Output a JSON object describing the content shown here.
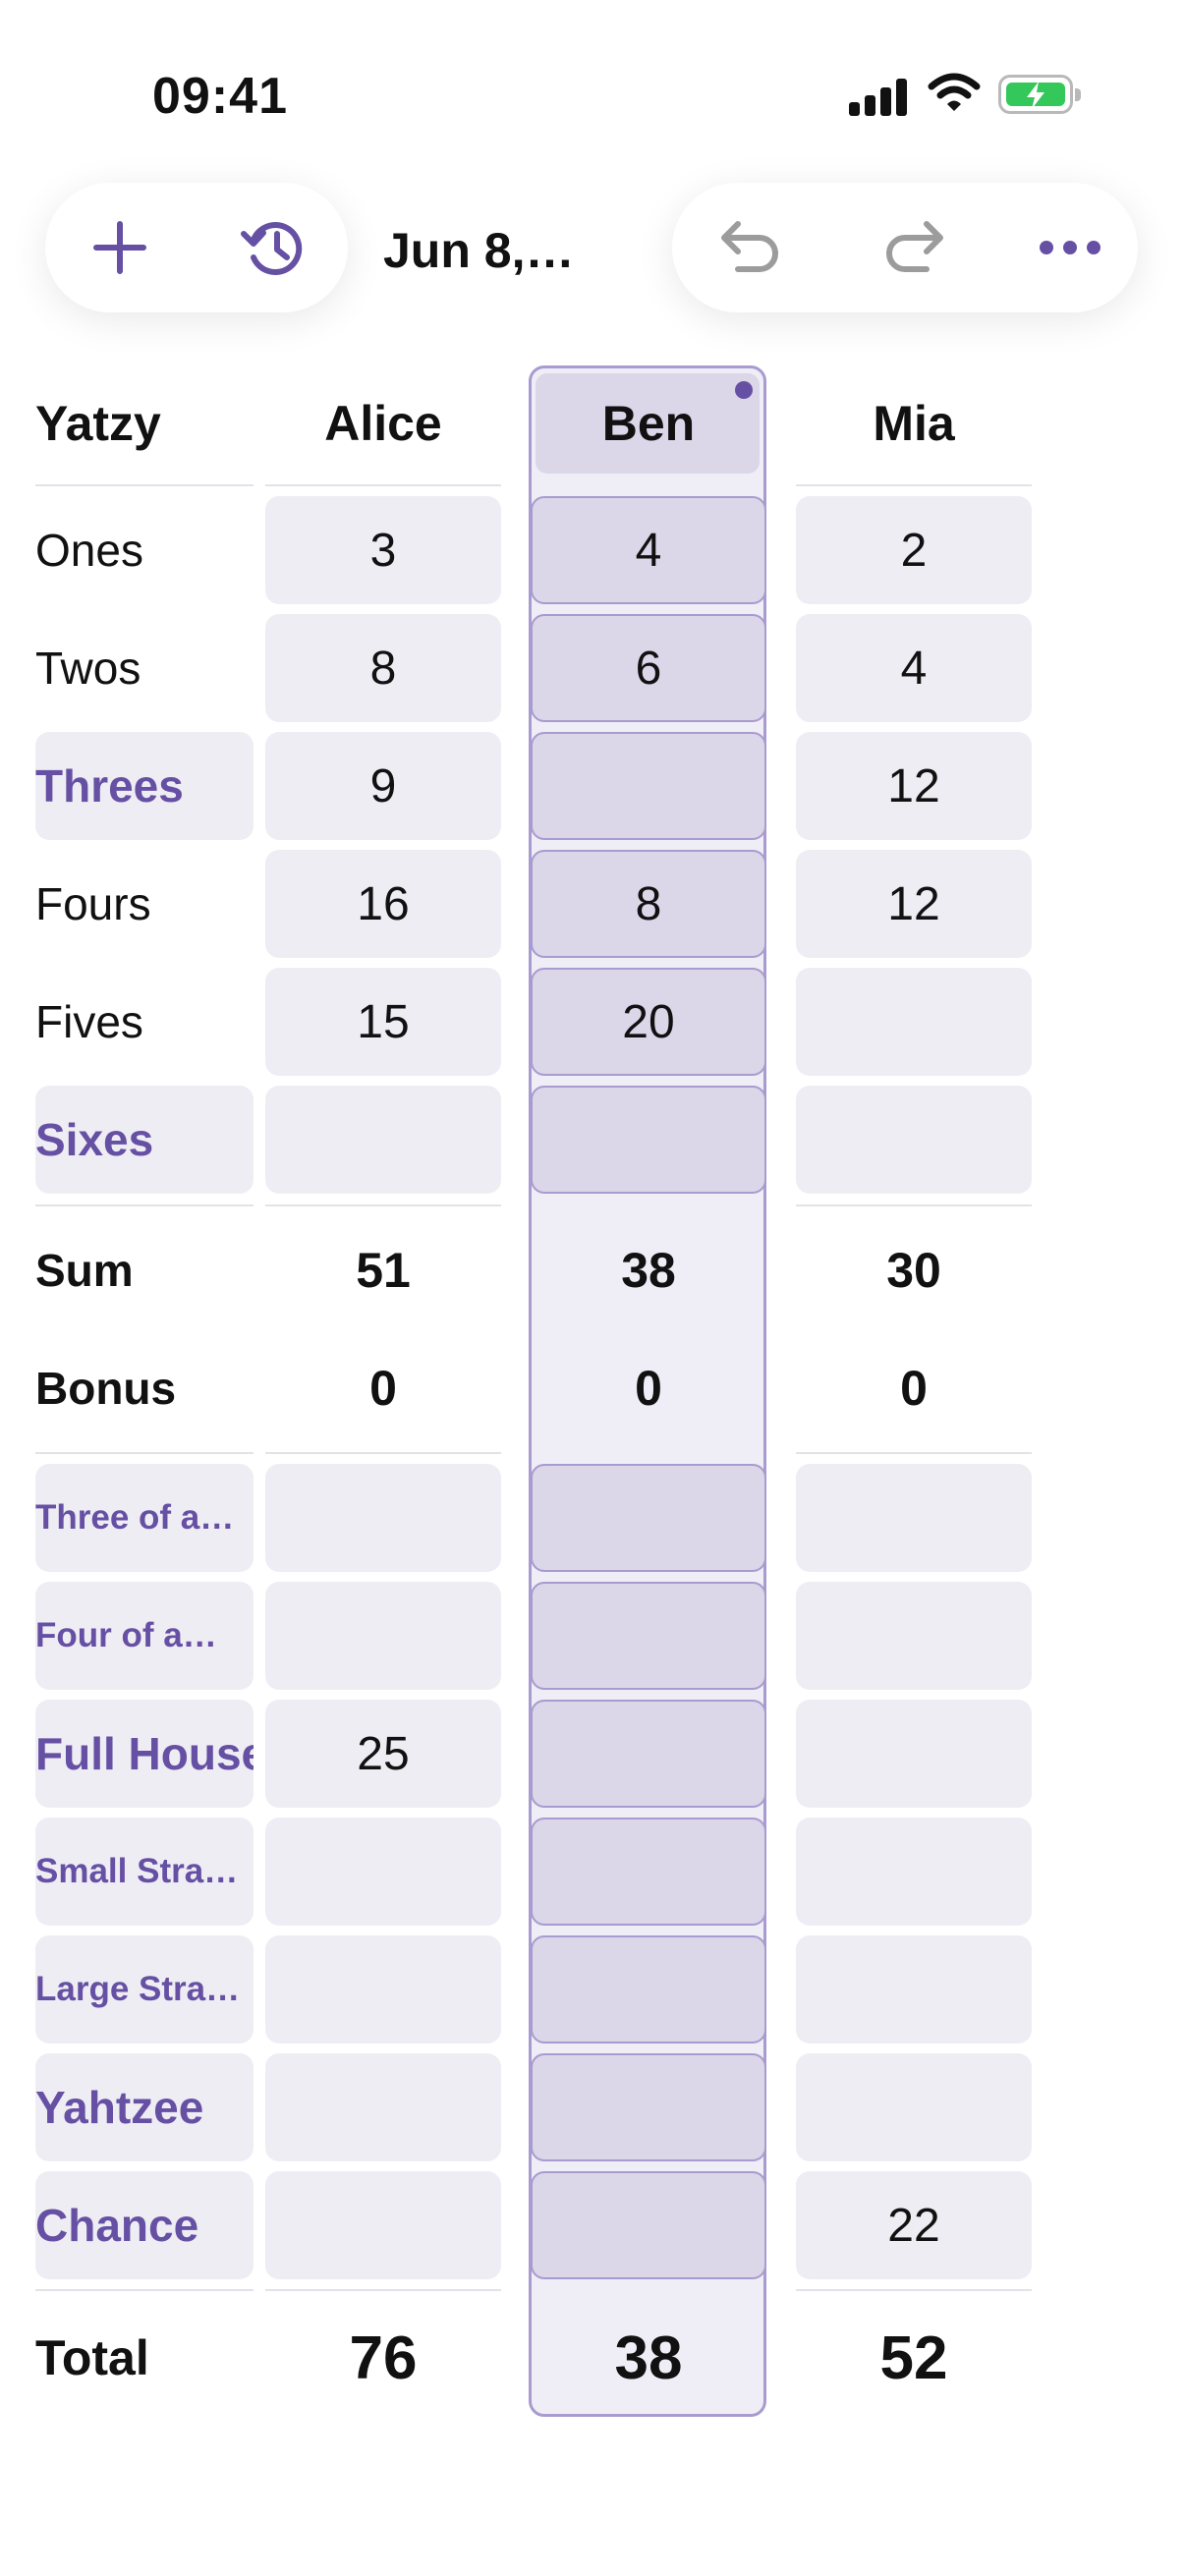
{
  "status_bar": {
    "time": "09:41"
  },
  "toolbar": {
    "date_title": "Jun 8,…"
  },
  "game": "Yatzy",
  "players": [
    "Alice",
    "Ben",
    "Mia"
  ],
  "upper_rows": [
    {
      "label": "Ones",
      "values": [
        "3",
        "4",
        "2"
      ]
    },
    {
      "label": "Twos",
      "values": [
        "8",
        "6",
        "4"
      ]
    },
    {
      "label": "Threes",
      "values": [
        "9",
        "",
        "12"
      ]
    },
    {
      "label": "Fours",
      "values": [
        "16",
        "8",
        "12"
      ]
    },
    {
      "label": "Fives",
      "values": [
        "15",
        "20",
        ""
      ]
    },
    {
      "label": "Sixes",
      "values": [
        "",
        "",
        ""
      ]
    }
  ],
  "sum": {
    "label": "Sum",
    "values": [
      "51",
      "38",
      "30"
    ]
  },
  "bonus": {
    "label": "Bonus",
    "values": [
      "0",
      "0",
      "0"
    ]
  },
  "lower_rows": [
    {
      "label": "Three of a…",
      "values": [
        "",
        "",
        ""
      ]
    },
    {
      "label": "Four of a…",
      "values": [
        "",
        "",
        ""
      ]
    },
    {
      "label": "Full House",
      "values": [
        "25",
        "",
        ""
      ]
    },
    {
      "label": "Small Stra…",
      "values": [
        "",
        "",
        ""
      ]
    },
    {
      "label": "Large Stra…",
      "values": [
        "",
        "",
        ""
      ]
    },
    {
      "label": "Yahtzee",
      "values": [
        "",
        "",
        ""
      ]
    },
    {
      "label": "Chance",
      "values": [
        "",
        "",
        "22"
      ]
    }
  ],
  "total": {
    "label": "Total",
    "values": [
      "76",
      "38",
      "52"
    ]
  },
  "colors": {
    "accent": "#6650a4",
    "cell": "#efedf4",
    "selected_cell": "#dcd6e9",
    "battery": "#34c759"
  }
}
